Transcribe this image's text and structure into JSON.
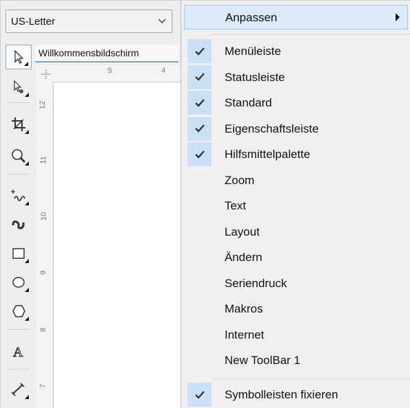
{
  "page_size": {
    "value": "US-Letter"
  },
  "doc_tab": {
    "title": "Willkommensbildschirm"
  },
  "rulers": {
    "h_ticks": [
      "5",
      "4"
    ],
    "v_ticks": [
      "12",
      "11",
      "10",
      "9",
      "8",
      "7"
    ]
  },
  "menu": {
    "header": "Anpassen",
    "items": [
      {
        "label": "Menüleiste",
        "checked": true
      },
      {
        "label": "Statusleiste",
        "checked": true
      },
      {
        "label": "Standard",
        "checked": true
      },
      {
        "label": "Eigenschaftsleiste",
        "checked": true
      },
      {
        "label": "Hilfsmittelpalette",
        "checked": true
      },
      {
        "label": "Zoom",
        "checked": false
      },
      {
        "label": "Text",
        "checked": false
      },
      {
        "label": "Layout",
        "checked": false
      },
      {
        "label": "Ändern",
        "checked": false
      },
      {
        "label": "Seriendruck",
        "checked": false
      },
      {
        "label": "Makros",
        "checked": false
      },
      {
        "label": "Internet",
        "checked": false
      },
      {
        "label": "New ToolBar 1",
        "checked": false
      }
    ],
    "footer_item": {
      "label": "Symbolleisten fixieren",
      "checked": true
    }
  },
  "tools": [
    {
      "icon": "pick-tool-icon"
    },
    {
      "icon": "shape-tool-icon"
    },
    {
      "icon": "crop-tool-icon"
    },
    {
      "icon": "zoom-tool-icon"
    },
    {
      "icon": "freehand-tool-icon"
    },
    {
      "icon": "artistic-media-icon"
    },
    {
      "icon": "rectangle-tool-icon"
    },
    {
      "icon": "ellipse-tool-icon"
    },
    {
      "icon": "polygon-tool-icon"
    },
    {
      "icon": "text-tool-icon"
    },
    {
      "icon": "dimension-tool-icon"
    }
  ],
  "colors": {
    "accent": "#6aa5d6",
    "check_bg": "#cce0f5",
    "highlight": "#dbe9f8"
  }
}
